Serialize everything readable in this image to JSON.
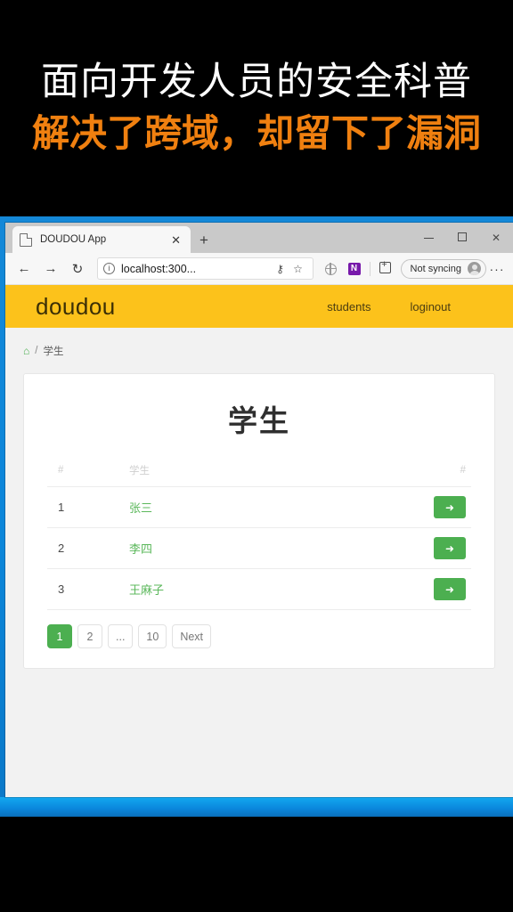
{
  "caption": {
    "line1": "面向开发人员的安全科普",
    "line2": "解决了跨域，却留下了漏洞",
    "line1_color": "#ffffff",
    "line2_color": "#f08010"
  },
  "browser": {
    "tab": {
      "title": "DOUDOU App",
      "close_label": "✕",
      "new_tab_label": "+"
    },
    "window_controls": {
      "minimize": "—",
      "maximize": "▫",
      "close": "✕"
    },
    "toolbar": {
      "back": "←",
      "forward": "→",
      "reload": "↻",
      "info_icon": "ⓘ",
      "url": "localhost:300...",
      "key_icon": "⚷",
      "star_icon": "☆",
      "onenote_label": "N",
      "sync_label": "Not syncing",
      "more_label": "···"
    }
  },
  "site": {
    "brand": "doudou",
    "nav_links": [
      "students",
      "loginout"
    ],
    "navbar_color": "#fcc21b"
  },
  "breadcrumb": {
    "home_icon": "⌂",
    "separator": "/",
    "current": "学生"
  },
  "card": {
    "title": "学生",
    "table": {
      "headers": [
        "#",
        "学生",
        "#"
      ],
      "rows": [
        {
          "id": "1",
          "name": "张三",
          "action_icon": "➜"
        },
        {
          "id": "2",
          "name": "李四",
          "action_icon": "➜"
        },
        {
          "id": "3",
          "name": "王麻子",
          "action_icon": "➜"
        }
      ]
    },
    "pagination": [
      {
        "label": "1",
        "active": true
      },
      {
        "label": "2",
        "active": false
      },
      {
        "label": "...",
        "active": false
      },
      {
        "label": "10",
        "active": false
      },
      {
        "label": "Next",
        "active": false
      }
    ],
    "accent_green": "#4caf50"
  }
}
